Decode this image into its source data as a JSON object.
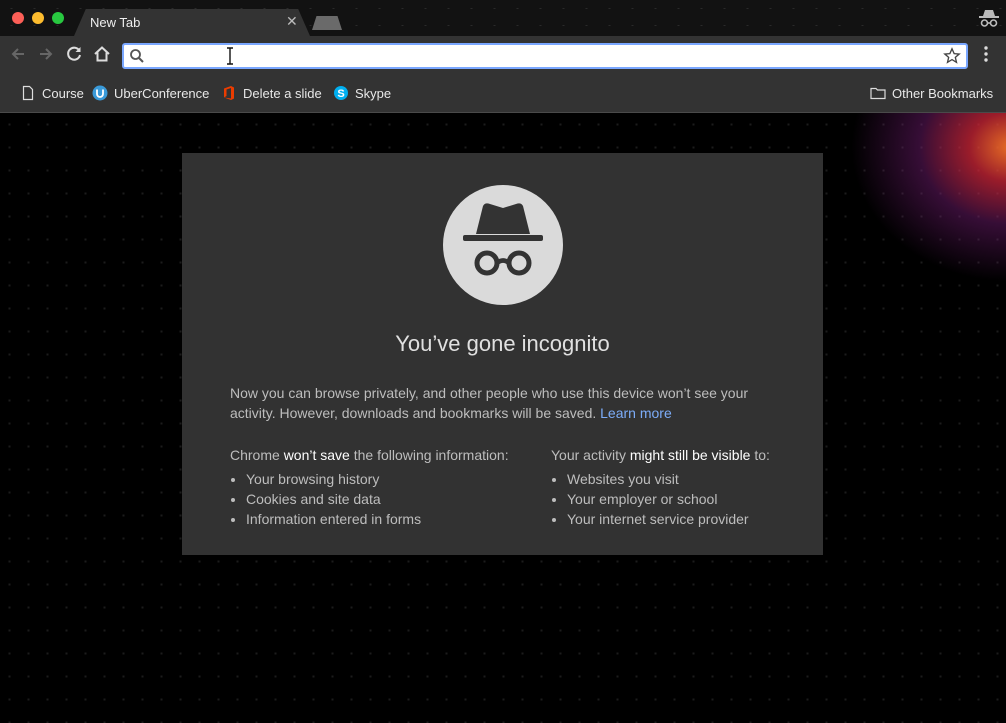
{
  "tab": {
    "title": "New Tab"
  },
  "omnibox": {
    "value": ""
  },
  "bookmarks": [
    {
      "label": "Course",
      "icon": "page-icon"
    },
    {
      "label": "UberConference",
      "icon": "uberconference-icon"
    },
    {
      "label": "Delete a slide",
      "icon": "office-icon"
    },
    {
      "label": "Skype",
      "icon": "skype-icon"
    }
  ],
  "other_bookmarks": "Other Bookmarks",
  "content": {
    "headline": "You’ve gone incognito",
    "intro": "Now you can browse privately, and other people who use this device won’t see your activity. However, downloads and bookmarks will be saved.",
    "learn_more": "Learn more",
    "left_heading_pre": "Chrome ",
    "left_heading_bold": "won’t save",
    "left_heading_post": " the following information:",
    "left_items": [
      "Your browsing history",
      "Cookies and site data",
      "Information entered in forms"
    ],
    "right_heading_pre": "Your activity ",
    "right_heading_bold": "might still be visible",
    "right_heading_post": " to:",
    "right_items": [
      "Websites you visit",
      "Your employer or school",
      "Your internet service provider"
    ]
  },
  "colors": {
    "accent": "#7aa7ff",
    "link": "#7cacf8",
    "card": "#323232",
    "chrome": "#333333"
  }
}
